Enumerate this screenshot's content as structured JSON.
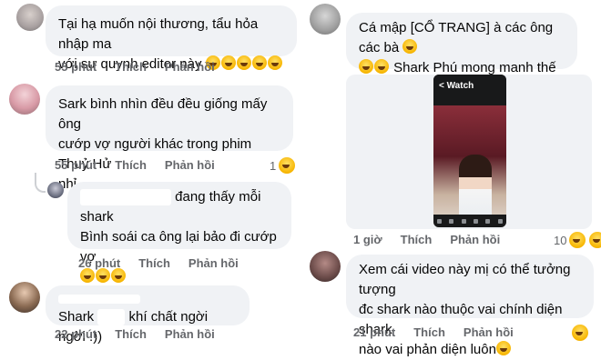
{
  "left": {
    "comments": [
      {
        "text": "Tại hạ muốn nội thương, tẩu hỏa nhập ma với sư quynh editor này",
        "line1": "Tại hạ muốn nội thương, tẩu hỏa nhập ma",
        "line2": "với sư quynh editor này",
        "time": "55 phút",
        "like": "Thích",
        "reply": "Phản hồi"
      },
      {
        "line1": "Sark bình nhìn đều đều giống mấy ông",
        "line2": "cướp vợ người khác trong phim Thuỷ Hử",
        "line3": "nhỉ",
        "time": "55 phút",
        "like": "Thích",
        "reply": "Phản hồi",
        "reaction_count": "1"
      },
      {
        "line1": "đang thấy mỗi shark",
        "line2": "Bình soái ca ông lại bảo đi cướp vợ",
        "time": "26 phút",
        "like": "Thích",
        "reply": "Phản hồi"
      },
      {
        "line1_prefix": "Shark",
        "line1_suffix": "khí chất ngời ngời :))",
        "time": "22 phút",
        "like": "Thích",
        "reply": "Phản hồi"
      }
    ]
  },
  "right": {
    "comments": [
      {
        "line1": "Cá mập [CỔ TRANG] à các ông các bà",
        "line2": "Shark Phú mong manh thế nhỉ",
        "video_header": "< Watch",
        "time": "1 giờ",
        "like": "Thích",
        "reply": "Phản hồi",
        "reaction_count": "10"
      },
      {
        "line1": "Xem cái video này mị có thể tưởng tượng",
        "line2": "đc shark nào thuộc vai chính diện shark",
        "line3": "nào vai phản diện luôn",
        "time": "21 phút",
        "like": "Thích",
        "reply": "Phản hồi"
      }
    ]
  }
}
